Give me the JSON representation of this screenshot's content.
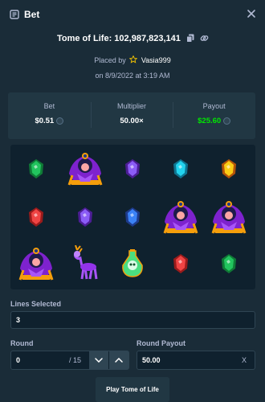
{
  "header": {
    "title": "Bet",
    "icon": "bet-slip-icon",
    "close_icon": "close-icon"
  },
  "bet_info": {
    "game_name": "Tome of Life",
    "bet_id": "102,987,823,141",
    "placed_by_prefix": "Placed by",
    "username": "Vasia999",
    "date_text": "on 8/9/2022 at 3:19 AM"
  },
  "stats": {
    "bet_label": "Bet",
    "bet_value": "$0.51",
    "multiplier_label": "Multiplier",
    "multiplier_value": "50.00×",
    "payout_label": "Payout",
    "payout_value": "$25.60"
  },
  "reels": [
    [
      "green-gem",
      "sorceress",
      "purple-gem",
      "cyan-gem",
      "yellow-gem"
    ],
    [
      "red-gem",
      "purple-gem",
      "blue-gem",
      "sorceress",
      "sorceress"
    ],
    [
      "sorceress",
      "deer",
      "skull-potion",
      "red-gem",
      "green-gem"
    ]
  ],
  "lines": {
    "label": "Lines Selected",
    "value": "3"
  },
  "round": {
    "label": "Round",
    "value": "0",
    "total": "/ 15"
  },
  "round_payout": {
    "label": "Round Payout",
    "value": "50.00",
    "clear": "X"
  },
  "play_button": "Play Tome of Life",
  "colors": {
    "bg": "#1a2c38",
    "panel": "#213743",
    "input": "#0f212e",
    "accent_green": "#00e701"
  }
}
